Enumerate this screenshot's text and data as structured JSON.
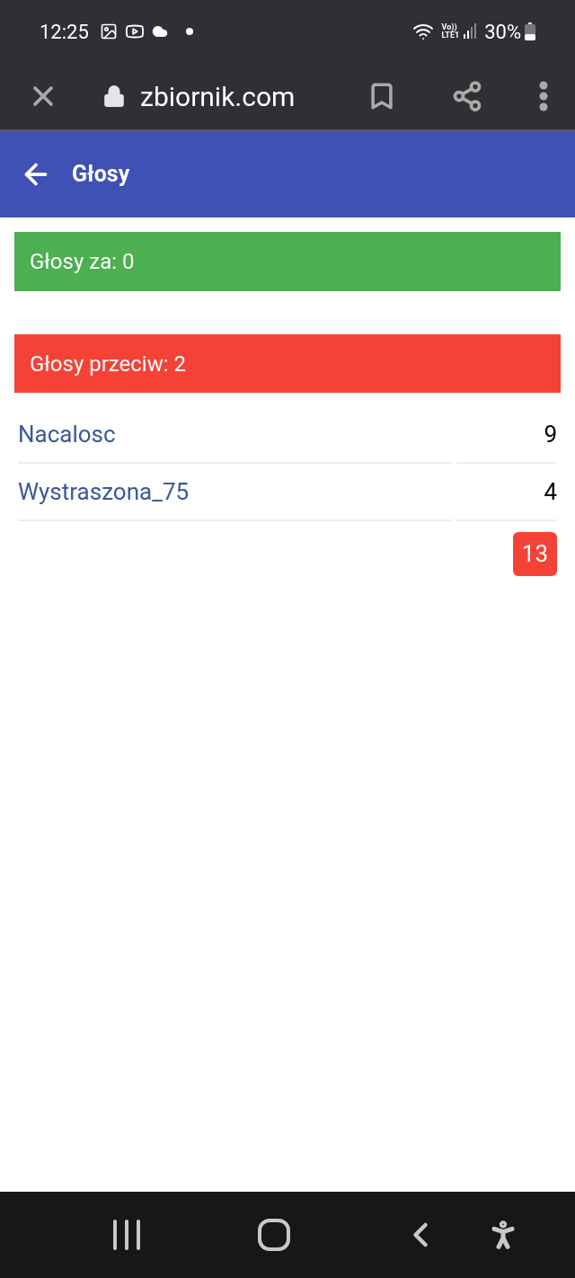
{
  "status_bar": {
    "time": "12:25",
    "network_top": "Vo))",
    "network_bottom": "LTE1",
    "battery": "30%"
  },
  "browser": {
    "url": "zbiornik.com"
  },
  "app_bar": {
    "title": "Głosy"
  },
  "votes_for": {
    "label": "Głosy za: 0"
  },
  "votes_against": {
    "label": "Głosy przeciw: 2"
  },
  "voters": [
    {
      "name": "Nacalosc",
      "count": "9"
    },
    {
      "name": "Wystraszona_75",
      "count": "4"
    }
  ],
  "total": "13"
}
